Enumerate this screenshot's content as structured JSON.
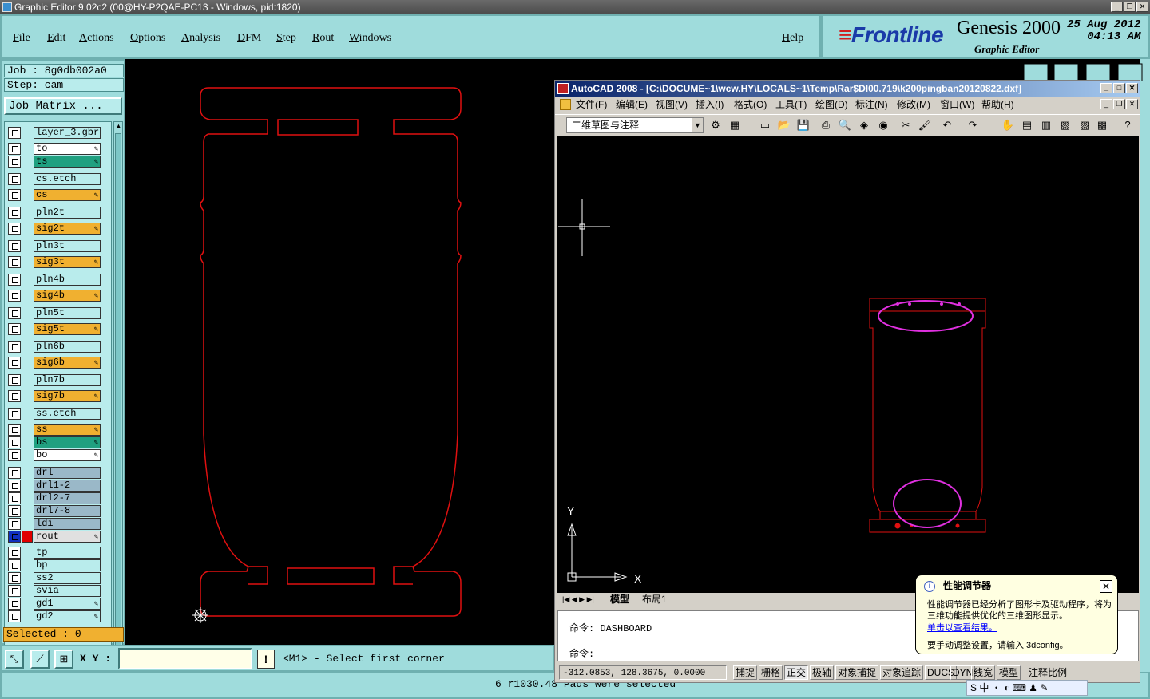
{
  "window_title": "Graphic Editor 9.02c2 (00@HY-P2QAE-PC13 - Windows, pid:1820)",
  "menu": [
    "File",
    "Edit",
    "Actions",
    "Options",
    "Analysis",
    "DFM",
    "Step",
    "Rout",
    "Windows"
  ],
  "help": "Help",
  "brand": {
    "logo": "Frontline",
    "product": "Genesis 2000",
    "subtitle": "Graphic Editor",
    "date": "25 Aug 2012",
    "time": "04:13 AM"
  },
  "job": {
    "job_label": "Job : 8g0db002a0",
    "step_label": "Step: cam",
    "job_matrix": "Job Matrix ..."
  },
  "layers": [
    {
      "name": "layer_3.gbr",
      "color": "#b9ecec",
      "edit": false
    },
    {
      "name": "to",
      "color": "#ffffff",
      "edit": true
    },
    {
      "name": "ts",
      "color": "#20a080",
      "edit": true
    },
    {
      "name": "cs.etch",
      "color": "#b9ecec",
      "edit": false
    },
    {
      "name": "cs",
      "color": "#f0b030",
      "edit": true
    },
    {
      "name": "pln2t",
      "color": "#b9ecec",
      "edit": false
    },
    {
      "name": "sig2t",
      "color": "#f0b030",
      "edit": true
    },
    {
      "name": "pln3t",
      "color": "#b9ecec",
      "edit": false
    },
    {
      "name": "sig3t",
      "color": "#f0b030",
      "edit": true
    },
    {
      "name": "pln4b",
      "color": "#b9ecec",
      "edit": false
    },
    {
      "name": "sig4b",
      "color": "#f0b030",
      "edit": true
    },
    {
      "name": "pln5t",
      "color": "#b9ecec",
      "edit": false
    },
    {
      "name": "sig5t",
      "color": "#f0b030",
      "edit": true
    },
    {
      "name": "pln6b",
      "color": "#b9ecec",
      "edit": false
    },
    {
      "name": "sig6b",
      "color": "#f0b030",
      "edit": true
    },
    {
      "name": "pln7b",
      "color": "#b9ecec",
      "edit": false
    },
    {
      "name": "sig7b",
      "color": "#f0b030",
      "edit": true
    },
    {
      "name": "ss.etch",
      "color": "#b9ecec",
      "edit": false
    },
    {
      "name": "ss",
      "color": "#f0b030",
      "edit": true
    },
    {
      "name": "bs",
      "color": "#20a080",
      "edit": true
    },
    {
      "name": "bo",
      "color": "#ffffff",
      "edit": true
    },
    {
      "name": "drl",
      "color": "#9ab8c8",
      "edit": false
    },
    {
      "name": "drl1-2",
      "color": "#9ab8c8",
      "edit": false
    },
    {
      "name": "drl2-7",
      "color": "#9ab8c8",
      "edit": false
    },
    {
      "name": "drl7-8",
      "color": "#9ab8c8",
      "edit": false
    },
    {
      "name": "ldi",
      "color": "#9ab8c8",
      "edit": false
    },
    {
      "name": "rout",
      "color": "#e0e0e0",
      "edit": true
    },
    {
      "name": "tp",
      "color": "#b9ecec",
      "edit": false
    },
    {
      "name": "bp",
      "color": "#b9ecec",
      "edit": false
    },
    {
      "name": "ss2",
      "color": "#b9ecec",
      "edit": false
    },
    {
      "name": "svia",
      "color": "#b9ecec",
      "edit": false
    },
    {
      "name": "gd1",
      "color": "#b9ecec",
      "edit": true
    },
    {
      "name": "gd2",
      "color": "#b9ecec",
      "edit": true
    }
  ],
  "selected": "Selected : 0",
  "xy_label": "X Y :",
  "xy_value": "",
  "prompt": "<M1> - Select first corner",
  "status_message": "6 r1030.48 Pads were selected",
  "colors": {
    "outline": "#e01010",
    "panel": "#9fdcdc",
    "magenta": "#e030e0"
  },
  "acad": {
    "title": "AutoCAD 2008 - [C:\\DOCUME~1\\wcw.HY\\LOCALS~1\\Temp\\Rar$DI00.719\\k200pingban20120822.dxf]",
    "menu": [
      "文件(F)",
      "编辑(E)",
      "视图(V)",
      "插入(I)",
      "格式(O)",
      "工具(T)",
      "绘图(D)",
      "标注(N)",
      "修改(M)",
      "窗口(W)",
      "帮助(H)"
    ],
    "workspace": "二维草图与注释",
    "tabs": [
      "模型",
      "布局1"
    ],
    "axis_x": "X",
    "axis_y": "Y",
    "cmd_line1": "命令: DASHBOARD",
    "cmd_line2": "命令:",
    "coords": "-312.0853, 128.3675, 0.0000",
    "status_buttons": [
      "捕捉",
      "栅格",
      "正交",
      "极轴",
      "对象捕捉",
      "对象追踪",
      "DUCS",
      "DYN",
      "线宽",
      "模型"
    ],
    "annot_scale": "注释比例"
  },
  "balloon": {
    "title": "性能调节器",
    "body": "性能调节器已经分析了图形卡及驱动程序，将为三维功能提供优化的三维图形显示。",
    "link": "单击以查看结果。",
    "footer": "要手动调整设置，请输入 3dconfig。"
  },
  "ime": "S 中 ・ ◐ ⌨ ♟ ✎"
}
